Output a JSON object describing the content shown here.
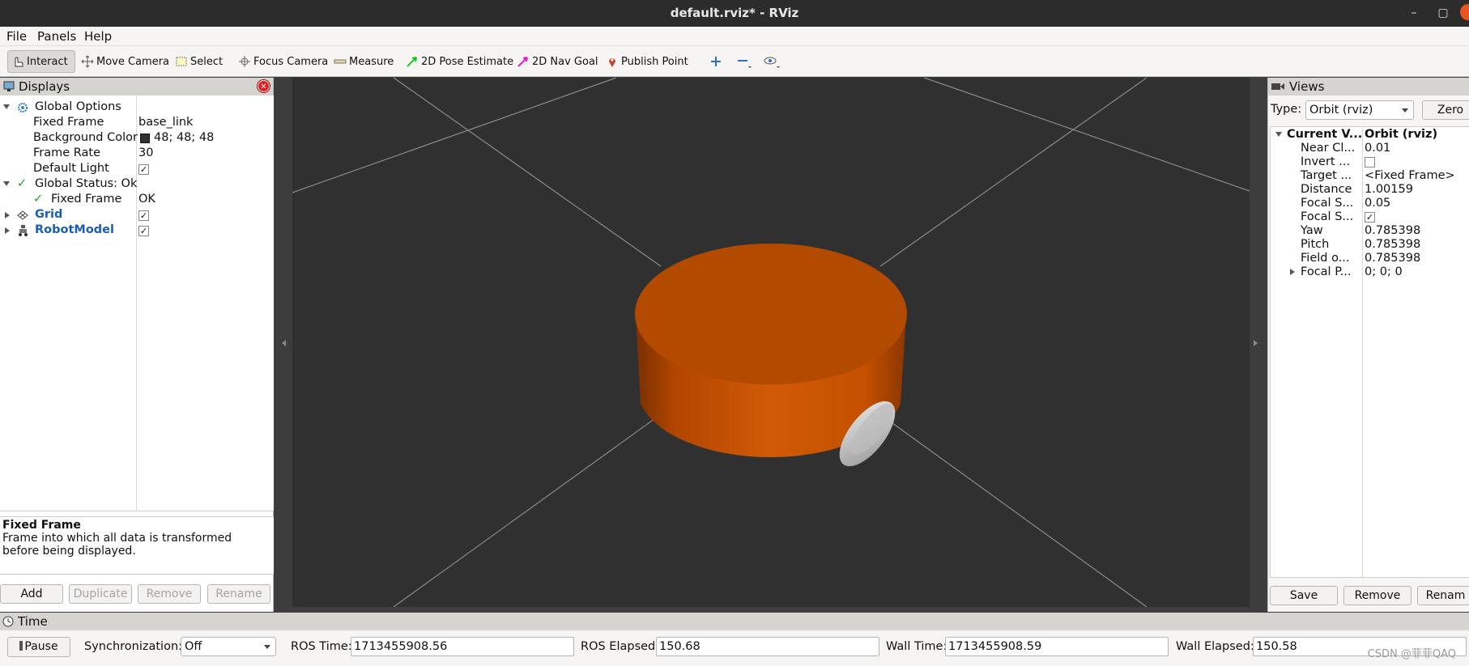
{
  "window": {
    "title": "default.rviz* - RViz"
  },
  "menu": [
    "File",
    "Panels",
    "Help"
  ],
  "toolbar": {
    "interact": "Interact",
    "move_camera": "Move Camera",
    "select": "Select",
    "focus_camera": "Focus Camera",
    "measure": "Measure",
    "pose_estimate": "2D Pose Estimate",
    "nav_goal": "2D Nav Goal",
    "publish_point": "Publish Point"
  },
  "displays": {
    "title": "Displays",
    "global_options": "Global Options",
    "fixed_frame_label": "Fixed Frame",
    "fixed_frame_value": "base_link",
    "bg_color_label": "Background Color",
    "bg_color_value": "48; 48; 48",
    "frame_rate_label": "Frame Rate",
    "frame_rate_value": "30",
    "default_light_label": "Default Light",
    "global_status": "Global Status: Ok",
    "status_fixed_frame": "Fixed Frame",
    "status_fixed_frame_value": "OK",
    "grid": "Grid",
    "robot_model": "RobotModel",
    "description_title": "Fixed Frame",
    "description_text": "Frame into which all data is transformed before being displayed.",
    "buttons": {
      "add": "Add",
      "duplicate": "Duplicate",
      "remove": "Remove",
      "rename": "Rename"
    }
  },
  "views": {
    "title": "Views",
    "type_label": "Type:",
    "type_value": "Orbit (rviz)",
    "zero_button": "Zero",
    "current_view_label": "Current V...",
    "current_view_value": "Orbit (rviz)",
    "props": [
      {
        "name": "Near Cl...",
        "value": "0.01"
      },
      {
        "name": "Invert ...",
        "value": ""
      },
      {
        "name": "Target ...",
        "value": "<Fixed Frame>"
      },
      {
        "name": "Distance",
        "value": "1.00159"
      },
      {
        "name": "Focal S...",
        "value": "0.05"
      },
      {
        "name": "Focal S...",
        "value": ""
      },
      {
        "name": "Yaw",
        "value": "0.785398"
      },
      {
        "name": "Pitch",
        "value": "0.785398"
      },
      {
        "name": "Field o...",
        "value": "0.785398"
      },
      {
        "name": "Focal P...",
        "value": "0; 0; 0"
      }
    ],
    "buttons": {
      "save": "Save",
      "remove": "Remove",
      "rename": "Renam"
    }
  },
  "time": {
    "title": "Time",
    "pause": "Pause",
    "sync_label": "Synchronization:",
    "sync_value": "Off",
    "ros_time_label": "ROS Time:",
    "ros_time": "1713455908.56",
    "ros_elapsed_label": "ROS Elapsed:",
    "ros_elapsed": "150.68",
    "wall_time_label": "Wall Time:",
    "wall_time": "1713455908.59",
    "wall_elapsed_label": "Wall Elapsed:",
    "wall_elapsed": "150.58"
  },
  "watermark": "CSDN @菲菲QAQ",
  "colors": {
    "robot_body": "#b84a00",
    "viewport_bg": "#303030",
    "wheel": "#c8c8c8"
  }
}
